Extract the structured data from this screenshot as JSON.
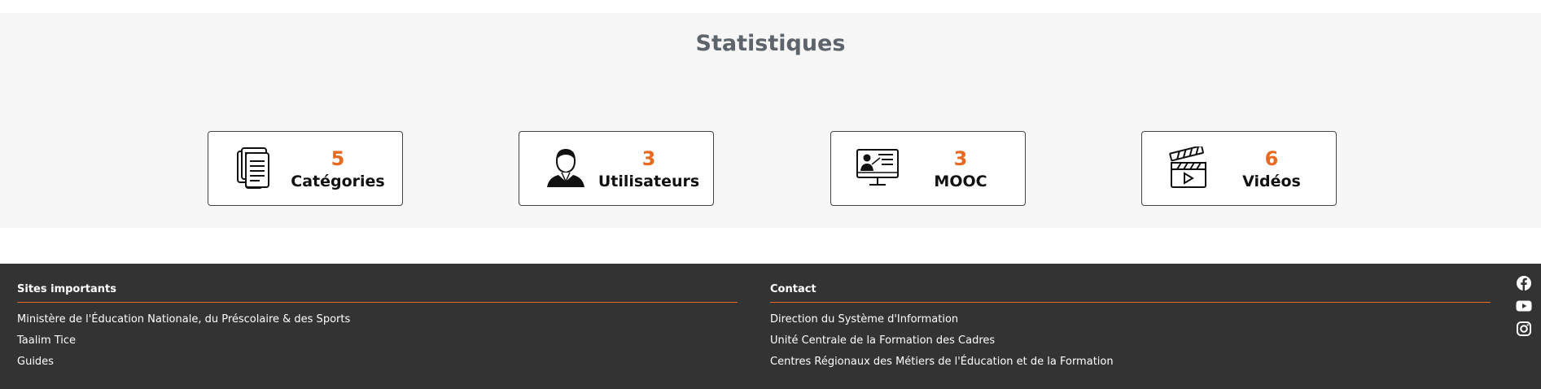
{
  "stats": {
    "title": "Statistiques",
    "cards": [
      {
        "count": "5",
        "label": "Catégories",
        "icon": "documents-icon"
      },
      {
        "count": "3",
        "label": "Utilisateurs",
        "icon": "user-icon"
      },
      {
        "count": "3",
        "label": "MOOC",
        "icon": "presentation-monitor-icon"
      },
      {
        "count": "6",
        "label": "Vidéos",
        "icon": "clapperboard-icon"
      }
    ]
  },
  "footer": {
    "sites": {
      "title": "Sites importants",
      "links": [
        "Ministère de l'Éducation Nationale, du Préscolaire & des Sports",
        "Taalim Tice",
        "Guides"
      ]
    },
    "contact": {
      "title": "Contact",
      "links": [
        "Direction du Système d'Information",
        "Unité Centrale de la Formation des Cadres",
        "Centres Régionaux des Métiers de l'Éducation et de la Formation"
      ]
    },
    "social": [
      "facebook-icon",
      "youtube-icon",
      "instagram-icon"
    ]
  },
  "colors": {
    "accent": "#e8691f",
    "footer_bg": "#333333",
    "section_bg": "#f7f7f7"
  }
}
